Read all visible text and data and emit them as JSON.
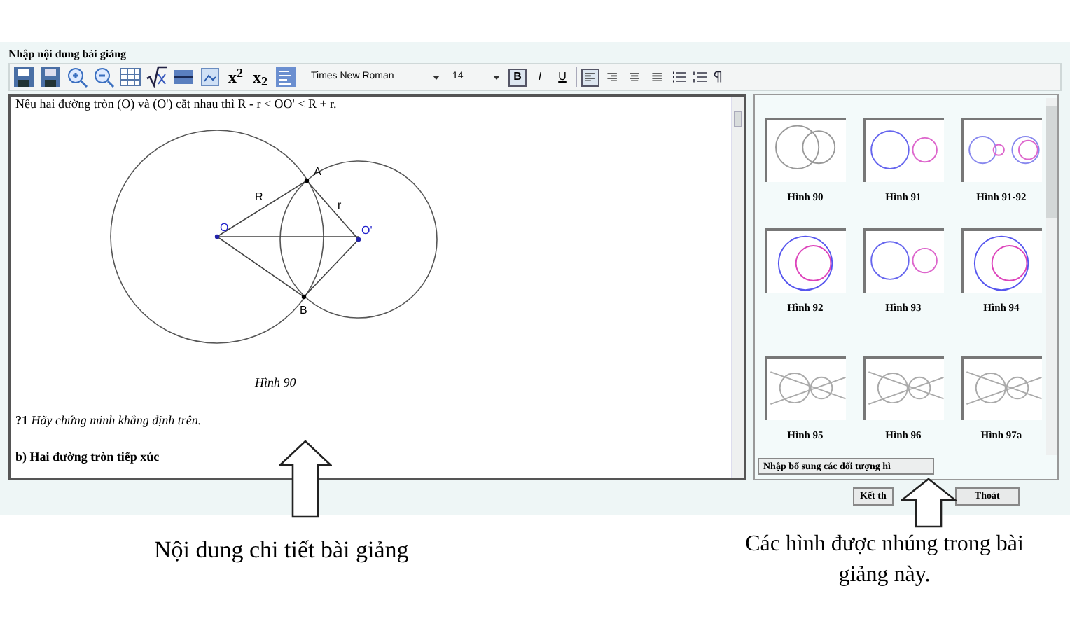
{
  "title": "Nhập nội dung bài giảng",
  "toolbar": {
    "superscript": "x$^{2}$",
    "subscript": "x$_{2}$",
    "font": "Times New Roman",
    "size": "14",
    "styles": [
      {
        "label": "B",
        "selected": true,
        "kind": "bold"
      },
      {
        "label": "I",
        "selected": false,
        "kind": "italic"
      },
      {
        "label": "U",
        "selected": false,
        "kind": "underline"
      }
    ],
    "alignments": [
      {
        "selected": true
      },
      {
        "selected": false
      },
      {
        "selected": false
      },
      {
        "selected": false
      }
    ]
  },
  "editor": {
    "top_line": "Nếu hai đường tròn (O) và (O') cắt nhau thì R - r < OO' < R + r.",
    "figure": {
      "labels": {
        "A": "A",
        "B": "B",
        "R": "R",
        "r": "r",
        "O": "O",
        "O2": "O'"
      },
      "caption": "Hình 90"
    },
    "question": "**?1** *Hãy chứng minh khẳng định trên.*",
    "heading": "b) Hai đường tròn tiếp xúc"
  },
  "figures": [
    {
      "label": "Hình 90",
      "kind": "intersect"
    },
    {
      "label": "Hình 91",
      "kind": "apart"
    },
    {
      "label": "Hình 91-92",
      "kind": "pair"
    },
    {
      "label": "Hình 92",
      "kind": "inner"
    },
    {
      "label": "Hình 93",
      "kind": "apart"
    },
    {
      "label": "Hình 94",
      "kind": "inner"
    },
    {
      "label": "Hình 95",
      "kind": "tangent"
    },
    {
      "label": "Hình 96",
      "kind": "tangent"
    },
    {
      "label": "Hình 97a",
      "kind": "tangent"
    }
  ],
  "add_button": "Nhập bổ sung các đối tượng hì",
  "buttons": [
    "Kết th",
    "Thoát"
  ],
  "captions": {
    "left": "Nội dung chi tiết bài giảng",
    "right": "Các hình được nhúng trong bài giảng này."
  }
}
